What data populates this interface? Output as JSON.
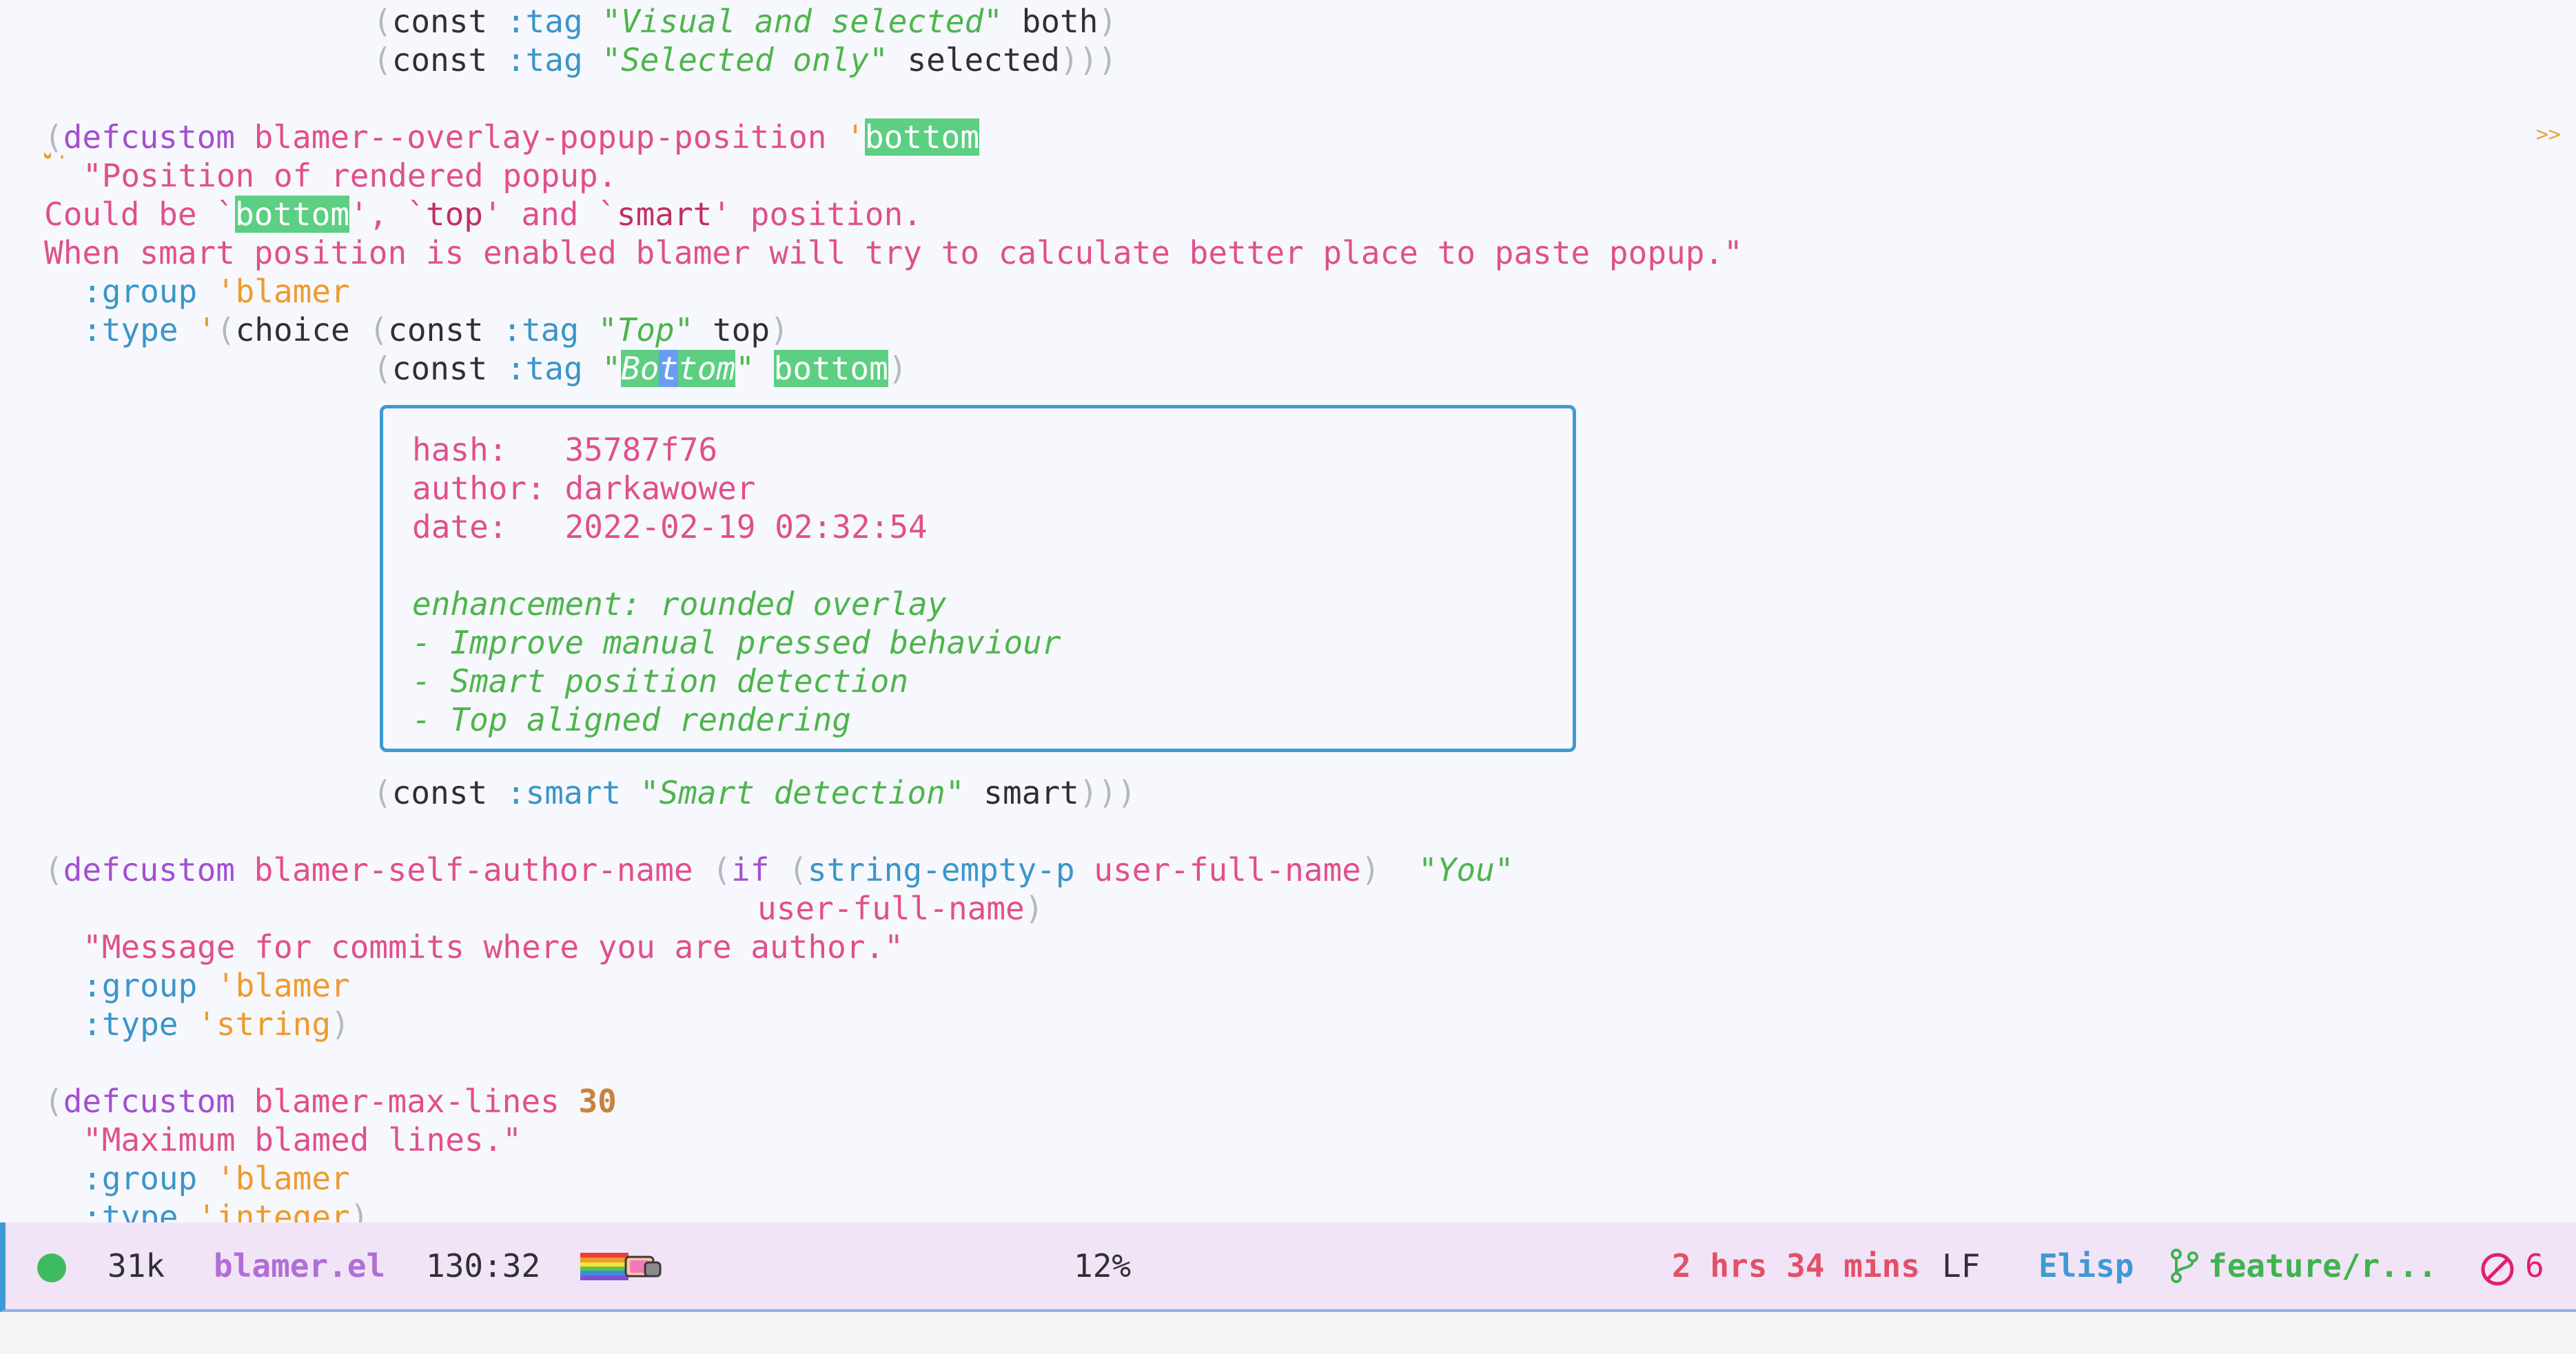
{
  "code": {
    "l1": {
      "a": "const ",
      "b": ":tag",
      "c": "\"Visual and selected\"",
      "d": " both"
    },
    "l2": {
      "a": "const ",
      "b": ":tag",
      "c": "\"Selected only\"",
      "d": " selected"
    },
    "l4": {
      "a": "defcustom",
      "b": "blamer--overlay-popup-position",
      "c": " '",
      "d": "bottom"
    },
    "l5": "\"Position of rendered popup.",
    "l6": {
      "a": "Could be `",
      "b": "bottom",
      "c": "', `",
      "d": "top",
      "e": "' and `",
      "f": "smart",
      "g": "' position."
    },
    "l7": "When smart position is enabled blamer will try to calculate better place to paste popup.\"",
    "l8": {
      "a": ":group",
      "b": " '",
      "c": "blamer"
    },
    "l9": {
      "a": ":type",
      "b": " '",
      "c": "choice ",
      "d": "const ",
      "e": ":tag",
      "f": "\"Top\"",
      "g": " top"
    },
    "l10": {
      "a": "const ",
      "b": ":tag",
      "c": "\"",
      "d": "Bo",
      "e": "t",
      "f": "tom",
      "g": "\"",
      "h": "bottom"
    },
    "l20": {
      "a": "const ",
      "b": ":smart",
      "c": "\"Smart detection\"",
      "d": " smart"
    },
    "l22": {
      "a": "defcustom",
      "b": "blamer-self-author-name",
      "c": "if",
      "d": "string-empty-p",
      "e": "user-full-name",
      "f": "\"You\""
    },
    "l23": "user-full-name",
    "l24": "\"Message for commits where you are author.\"",
    "l25": {
      "a": ":group",
      "b": " '",
      "c": "blamer"
    },
    "l26": {
      "a": ":type",
      "b": " '",
      "c": "string"
    },
    "l28": {
      "a": "defcustom",
      "b": "blamer-max-lines",
      "c": "30"
    },
    "l29": "\"Maximum blamed lines.\"",
    "l30": {
      "a": ":group",
      "b": " '",
      "c": "blamer"
    },
    "l31": {
      "a": ":type",
      "b": " '",
      "c": "integer"
    }
  },
  "fringe_marker": ">>",
  "popup": {
    "hash_label": "hash:   ",
    "hash": "35787f76",
    "author_label": "author: ",
    "author": "darkawower",
    "date_label": "date:   ",
    "date": "2022-02-19 02:32:54",
    "message": [
      "enhancement: rounded overlay",
      "- Improve manual pressed behaviour",
      "- Smart position detection",
      "- Top aligned rendering"
    ]
  },
  "modeline": {
    "size": "31k",
    "filename": "blamer.el",
    "position": "130:32",
    "percent": "12%",
    "time": "2 hrs 34 mins",
    "eol": "LF",
    "mode": "Elisp",
    "branch": "feature/r...",
    "errors": "6",
    "colors": {
      "filename": "#b06fd6",
      "time": "#e2506a",
      "mode": "#3e9ad3",
      "branch": "#3fb34f",
      "errors": "#e0206a"
    }
  }
}
